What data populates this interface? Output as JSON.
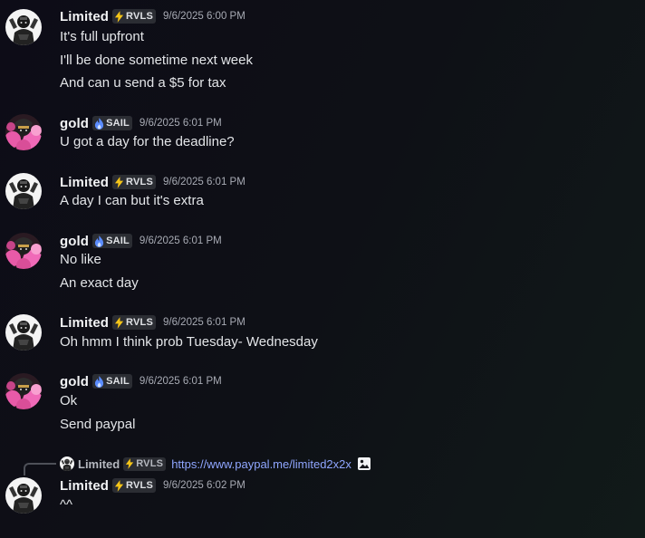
{
  "colors": {
    "username": "#f2f3f5",
    "timestamp": "#a8abb4",
    "link": "#8fa6ff",
    "tag_bg": "#2b2d33",
    "rvls_icon": "#f5c518",
    "sail_icon": "#5b8cff"
  },
  "messages": [
    {
      "author": "Limited",
      "tag": "RVLS",
      "tag_icon": "lightning-icon",
      "timestamp": "9/6/2025 6:00 PM",
      "lines": [
        "It's full upfront",
        "I'll be done sometime next week",
        "And can u send a $5 for tax"
      ]
    },
    {
      "author": "gold",
      "tag": "SAIL",
      "tag_icon": "flame-icon",
      "timestamp": "9/6/2025 6:01 PM",
      "lines": [
        "U got a day for the deadline?"
      ]
    },
    {
      "author": "Limited",
      "tag": "RVLS",
      "tag_icon": "lightning-icon",
      "timestamp": "9/6/2025 6:01 PM",
      "lines": [
        "A day I can but it's extra"
      ]
    },
    {
      "author": "gold",
      "tag": "SAIL",
      "tag_icon": "flame-icon",
      "timestamp": "9/6/2025 6:01 PM",
      "lines": [
        "No like",
        "An exact day"
      ]
    },
    {
      "author": "Limited",
      "tag": "RVLS",
      "tag_icon": "lightning-icon",
      "timestamp": "9/6/2025 6:01 PM",
      "lines": [
        "Oh hmm I think prob Tuesday- Wednesday"
      ]
    },
    {
      "author": "gold",
      "tag": "SAIL",
      "tag_icon": "flame-icon",
      "timestamp": "9/6/2025 6:01 PM",
      "lines": [
        "Ok",
        "Send paypal"
      ]
    },
    {
      "author": "Limited",
      "tag": "RVLS",
      "tag_icon": "lightning-icon",
      "timestamp": "9/6/2025 6:02 PM",
      "lines": [
        "^^"
      ],
      "reply": {
        "author": "Limited",
        "tag": "RVLS",
        "text": "https://www.paypal.me/limited2x2x",
        "attachment_icon": "image-icon"
      }
    }
  ]
}
